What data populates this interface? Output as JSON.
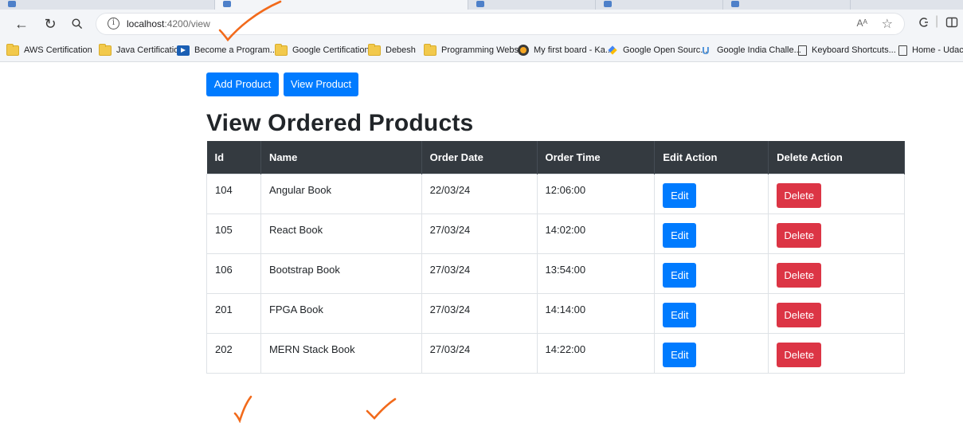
{
  "browser": {
    "url_host": "localhost",
    "url_path": ":4200/view",
    "read_aloud": "Aᴬ",
    "bookmarks": [
      {
        "label": "AWS Certification",
        "icon": "folder-icon"
      },
      {
        "label": "Java Certification",
        "icon": "folder-icon"
      },
      {
        "label": "Become a Program...",
        "icon": "video-icon"
      },
      {
        "label": "Google Certification",
        "icon": "folder-icon"
      },
      {
        "label": "Debesh",
        "icon": "folder-icon"
      },
      {
        "label": "Programming Webs...",
        "icon": "folder-icon"
      },
      {
        "label": "My first board - Ka...",
        "icon": "board-icon"
      },
      {
        "label": "Google Open Sourc...",
        "icon": "kite-icon"
      },
      {
        "label": "Google India Challe...",
        "icon": "udemy-icon"
      },
      {
        "label": "Keyboard Shortcuts...",
        "icon": "page-icon"
      },
      {
        "label": "Home - Udacity",
        "icon": "page-icon"
      }
    ]
  },
  "nav": {
    "add_label": "Add Product",
    "view_label": "View Product"
  },
  "page": {
    "title": "View Ordered Products"
  },
  "table": {
    "headers": [
      "Id",
      "Name",
      "Order Date",
      "Order Time",
      "Edit Action",
      "Delete Action"
    ],
    "edit_label": "Edit",
    "delete_label": "Delete",
    "rows": [
      {
        "id": "104",
        "name": "Angular Book",
        "date": "22/03/24",
        "time": "12:06:00"
      },
      {
        "id": "105",
        "name": "React Book",
        "date": "27/03/24",
        "time": "14:02:00"
      },
      {
        "id": "106",
        "name": "Bootstrap Book",
        "date": "27/03/24",
        "time": "13:54:00"
      },
      {
        "id": "201",
        "name": "FPGA Book",
        "date": "27/03/24",
        "time": "14:14:00"
      },
      {
        "id": "202",
        "name": "MERN Stack Book",
        "date": "27/03/24",
        "time": "14:22:00"
      }
    ]
  },
  "colors": {
    "primary": "#007bff",
    "danger": "#dc3545",
    "table_header": "#343a40",
    "annotation": "#f26a1b"
  }
}
